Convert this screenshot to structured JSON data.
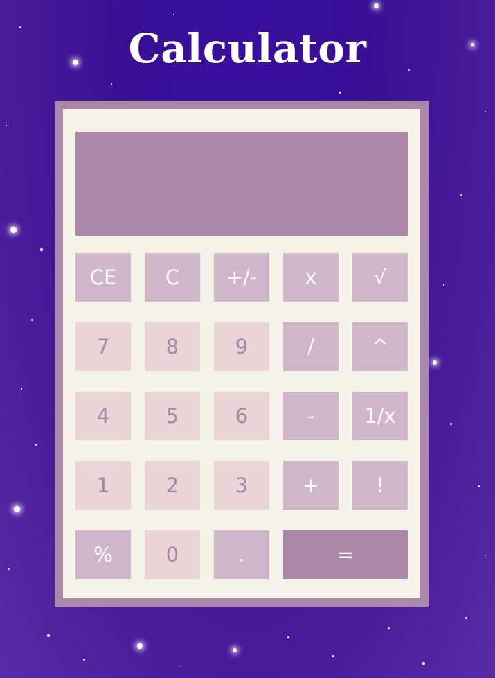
{
  "title": "Calculator",
  "display": {
    "value": ""
  },
  "keys": {
    "ce": "CE",
    "c": "C",
    "sign": "+/-",
    "multiply": "x",
    "sqrt": "√",
    "seven": "7",
    "eight": "8",
    "nine": "9",
    "divide": "/",
    "power": "^",
    "four": "4",
    "five": "5",
    "six": "6",
    "minus": "-",
    "reciprocal": "1/x",
    "one": "1",
    "two": "2",
    "three": "3",
    "plus": "+",
    "factorial": "!",
    "percent": "%",
    "zero": "0",
    "dot": ".",
    "equals": "="
  },
  "colors": {
    "frame": "#ab87aa",
    "panel": "#f5f2ea",
    "display": "#ab87aa",
    "operator_key": "#cfb7c9",
    "number_key": "#ebd4d7",
    "equals_key": "#ab87aa",
    "background": "#3a0f95"
  }
}
